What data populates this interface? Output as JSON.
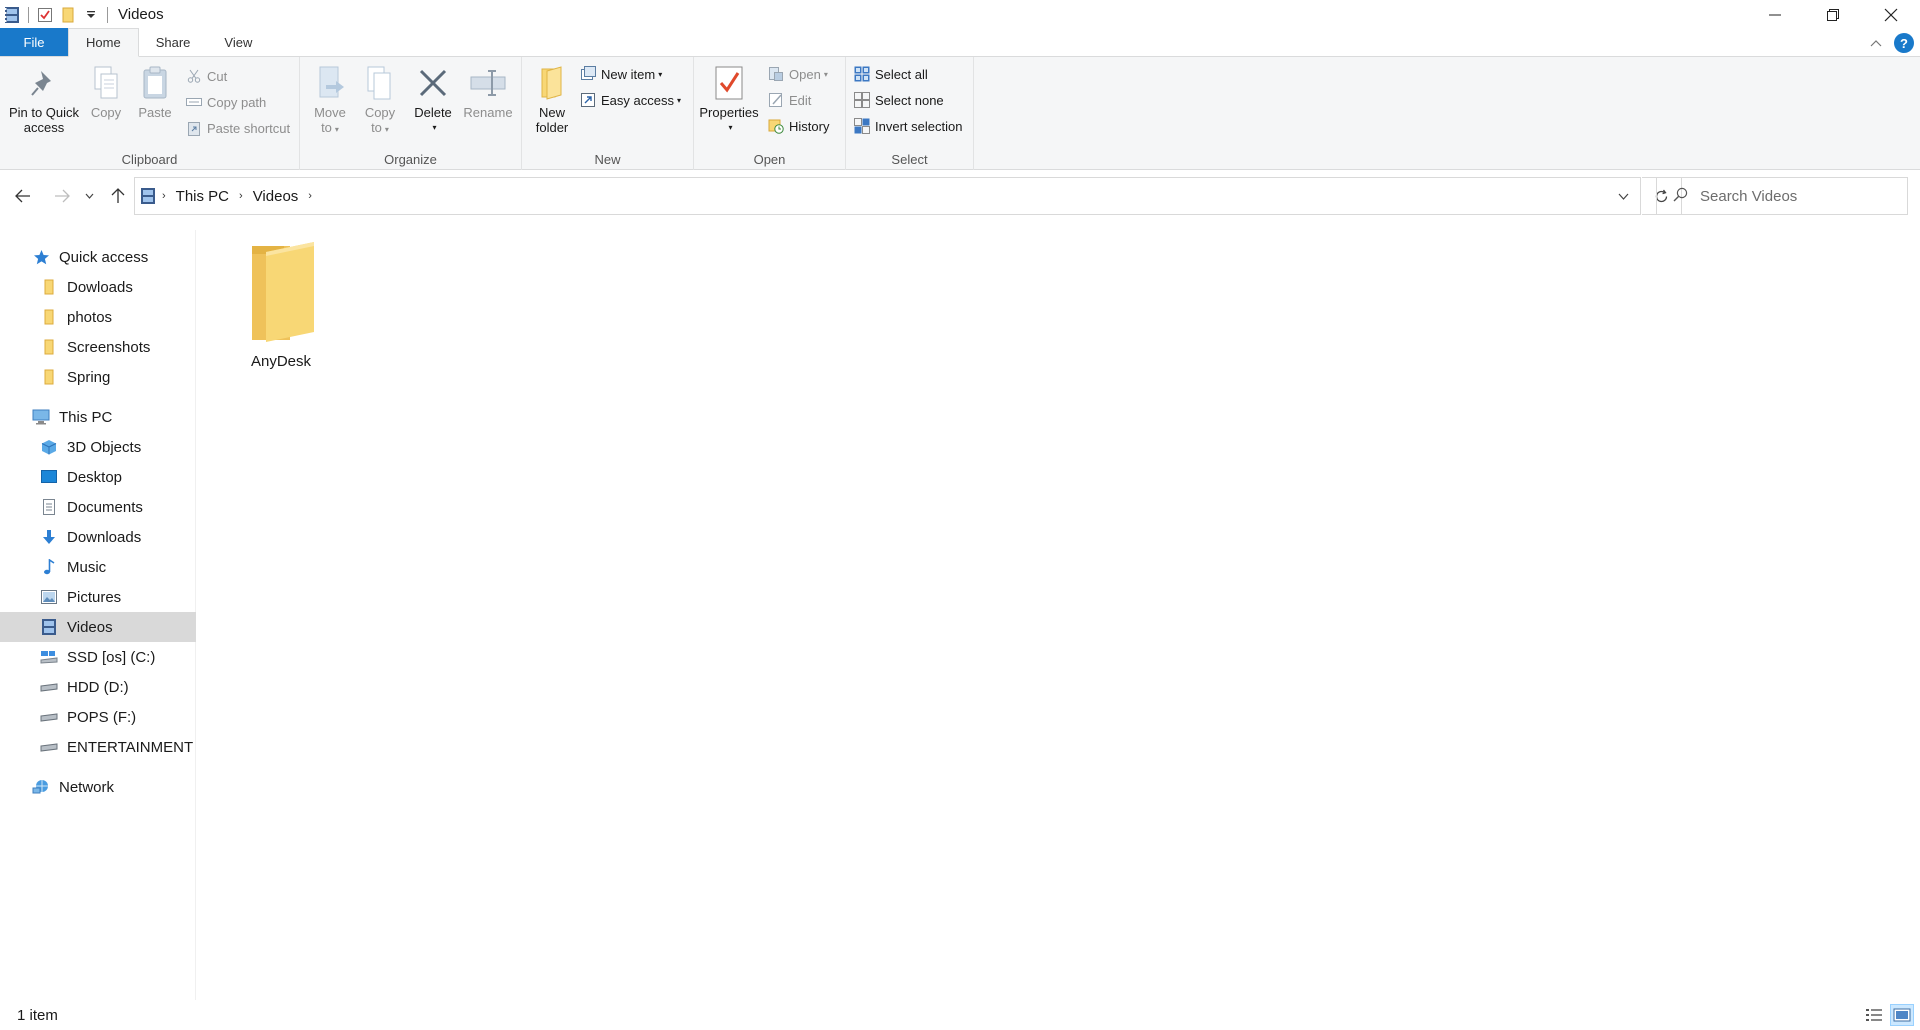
{
  "window": {
    "title": "Videos"
  },
  "ribbon_tabs": {
    "file": "File",
    "home": "Home",
    "share": "Share",
    "view": "View",
    "help": "?"
  },
  "clipboard": {
    "pin_line1": "Pin to Quick",
    "pin_line2": "access",
    "copy": "Copy",
    "paste": "Paste",
    "cut": "Cut",
    "copy_path": "Copy path",
    "paste_shortcut": "Paste shortcut",
    "group": "Clipboard"
  },
  "organize": {
    "move_line1": "Move",
    "move_line2": "to",
    "copy_line1": "Copy",
    "copy_line2": "to",
    "delete": "Delete",
    "rename": "Rename",
    "group": "Organize"
  },
  "new_group": {
    "new_folder_line1": "New",
    "new_folder_line2": "folder",
    "new_item": "New item",
    "easy_access": "Easy access",
    "group": "New"
  },
  "open_group": {
    "properties": "Properties",
    "open": "Open",
    "edit": "Edit",
    "history": "History",
    "group": "Open"
  },
  "select_group": {
    "select_all": "Select all",
    "select_none": "Select none",
    "invert": "Invert selection",
    "group": "Select"
  },
  "address": {
    "crumbs": [
      "This PC",
      "Videos"
    ],
    "search_placeholder": "Search Videos"
  },
  "nav": {
    "quick_access": "Quick access",
    "quick_items": [
      "Dowloads",
      "photos",
      "Screenshots",
      "Spring"
    ],
    "this_pc": "This PC",
    "pc_items": [
      "3D Objects",
      "Desktop",
      "Documents",
      "Downloads",
      "Music",
      "Pictures",
      "Videos",
      "SSD [os] (C:)",
      "HDD (D:)",
      "POPS (F:)",
      "ENTERTAINMENT (G:)"
    ],
    "network": "Network",
    "selected": "Videos"
  },
  "content": {
    "items": [
      "AnyDesk"
    ]
  },
  "status": {
    "count": "1 item"
  },
  "colors": {
    "accent": "#1979ca",
    "folder": "#f8d775",
    "selection": "#d9d9d9"
  }
}
